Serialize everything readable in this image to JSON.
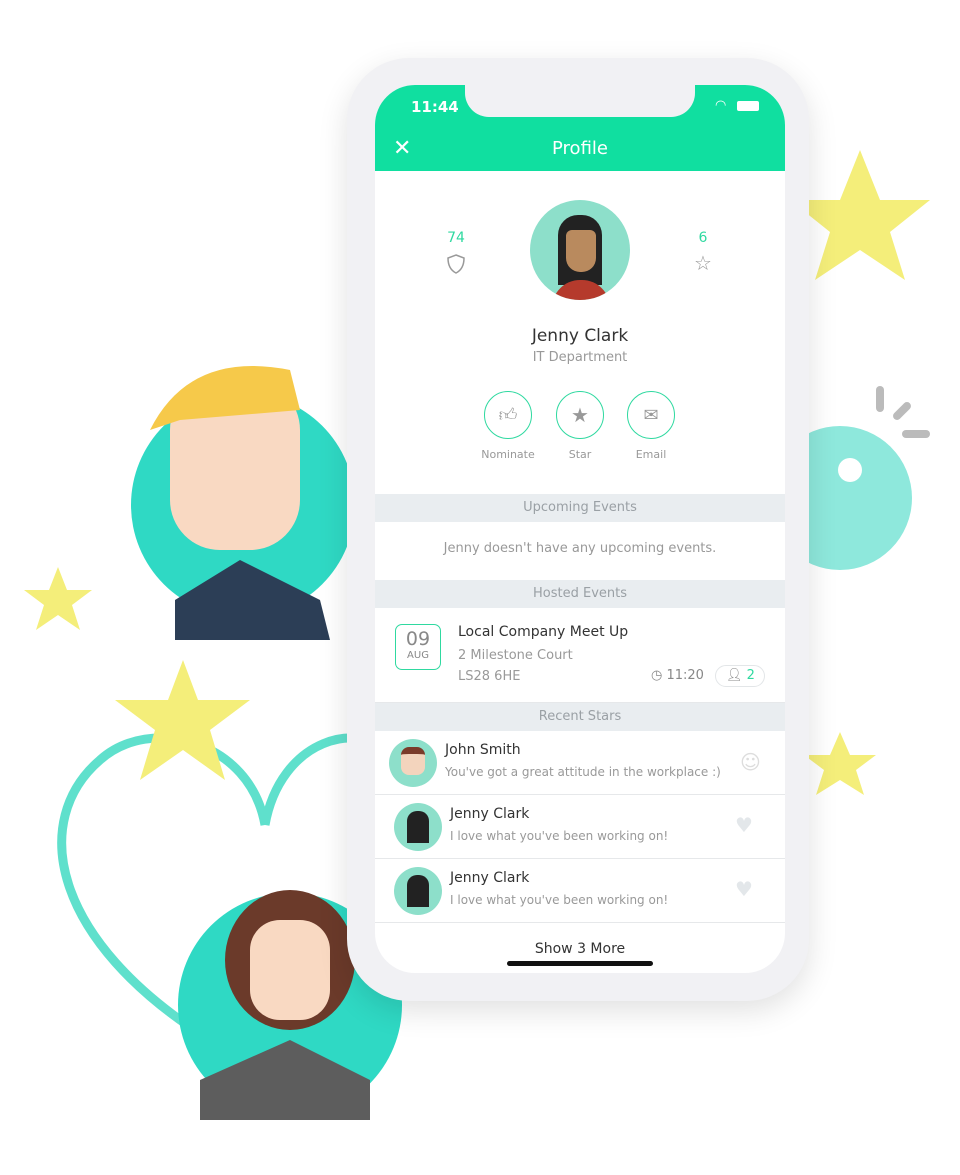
{
  "status": {
    "time": "11:44"
  },
  "header": {
    "title": "Profile",
    "close_icon": "close-icon"
  },
  "profile": {
    "name": "Jenny Clark",
    "department": "IT Department",
    "badges_count": "74",
    "stars_count": "6"
  },
  "actions": [
    {
      "label": "Nominate",
      "icon": "thumbs-up-icon"
    },
    {
      "label": "Star",
      "icon": "star-icon"
    },
    {
      "label": "Email",
      "icon": "envelope-icon"
    }
  ],
  "upcoming": {
    "title": "Upcoming Events",
    "empty": "Jenny doesn't have any upcoming events."
  },
  "hosted": {
    "title": "Hosted Events",
    "event": {
      "day": "09",
      "month": "AUG",
      "name": "Local Company Meet Up",
      "address1": "2 Milestone Court",
      "address2": "LS28 6HE",
      "time": "11:20",
      "attendees": "2"
    }
  },
  "stars": {
    "title": "Recent Stars",
    "items": [
      {
        "name": "John Smith",
        "message": "You've got a great attitude in the workplace :)",
        "icon": "smiley-icon"
      },
      {
        "name": "Jenny Clark",
        "message": "I love what you've been working on!",
        "icon": "heart-icon"
      },
      {
        "name": "Jenny Clark",
        "message": "I love what you've been working on!",
        "icon": "heart-icon"
      }
    ],
    "more": "Show 3 More"
  },
  "colors": {
    "accent": "#10dfa0",
    "teal": "#2fd9c4",
    "star": "#f4ee7a"
  }
}
